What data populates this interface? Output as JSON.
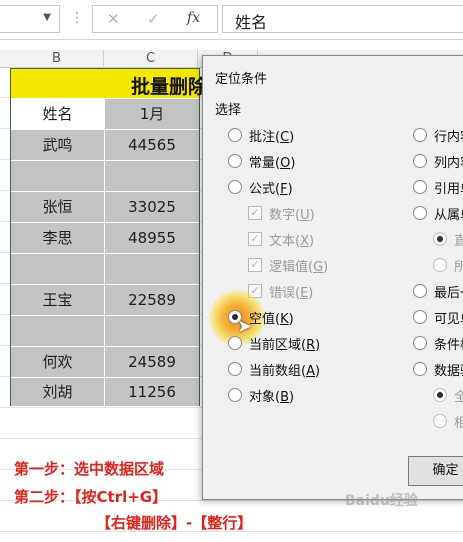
{
  "formula_bar": {
    "namebox_arrow": "▼",
    "separator": "⋮",
    "cancel_icon": "✕",
    "enter_icon": "✓",
    "fx_label": "fx",
    "content": "姓名"
  },
  "columns": [
    "B",
    "C",
    "D"
  ],
  "table": {
    "title": "批量删除",
    "header": {
      "name": "姓名",
      "month": "1月"
    },
    "rows": [
      {
        "name": "武鸣",
        "value": "44565"
      },
      {
        "name": "",
        "value": ""
      },
      {
        "name": "张恒",
        "value": "33025"
      },
      {
        "name": "李思",
        "value": "48955"
      },
      {
        "name": "",
        "value": ""
      },
      {
        "name": "王宝",
        "value": "22589"
      },
      {
        "name": "",
        "value": ""
      },
      {
        "name": "何欢",
        "value": "24589"
      },
      {
        "name": "刘胡",
        "value": "11256"
      }
    ]
  },
  "instructions": {
    "step1": "第一步：选中数据区域",
    "step2": "第二步：【按Ctrl+G】",
    "step3": "【右键删除】-【整行】"
  },
  "dialog": {
    "title": "定位条件",
    "section": "选择",
    "left_options": [
      {
        "label": "批注(",
        "key": "C",
        "end": ")"
      },
      {
        "label": "常量(",
        "key": "O",
        "end": ")"
      },
      {
        "label": "公式(",
        "key": "F",
        "end": ")"
      },
      {
        "label": "数字(",
        "key": "U",
        "end": ")"
      },
      {
        "label": "文本(",
        "key": "X",
        "end": ")"
      },
      {
        "label": "逻辑值(",
        "key": "G",
        "end": ")"
      },
      {
        "label": "错误(",
        "key": "E",
        "end": ")"
      },
      {
        "label": "空值(",
        "key": "K",
        "end": ")"
      },
      {
        "label": "当前区域(",
        "key": "R",
        "end": ")"
      },
      {
        "label": "当前数组(",
        "key": "A",
        "end": ")"
      },
      {
        "label": "对象(",
        "key": "B",
        "end": ")"
      }
    ],
    "right_options": [
      "行内容",
      "列内容",
      "引用单",
      "从属单",
      "直",
      "所",
      "最后一",
      "可见单",
      "条件格",
      "数据验",
      "全",
      "相"
    ],
    "ok_button": "确定"
  },
  "watermark": "Baidu经验"
}
